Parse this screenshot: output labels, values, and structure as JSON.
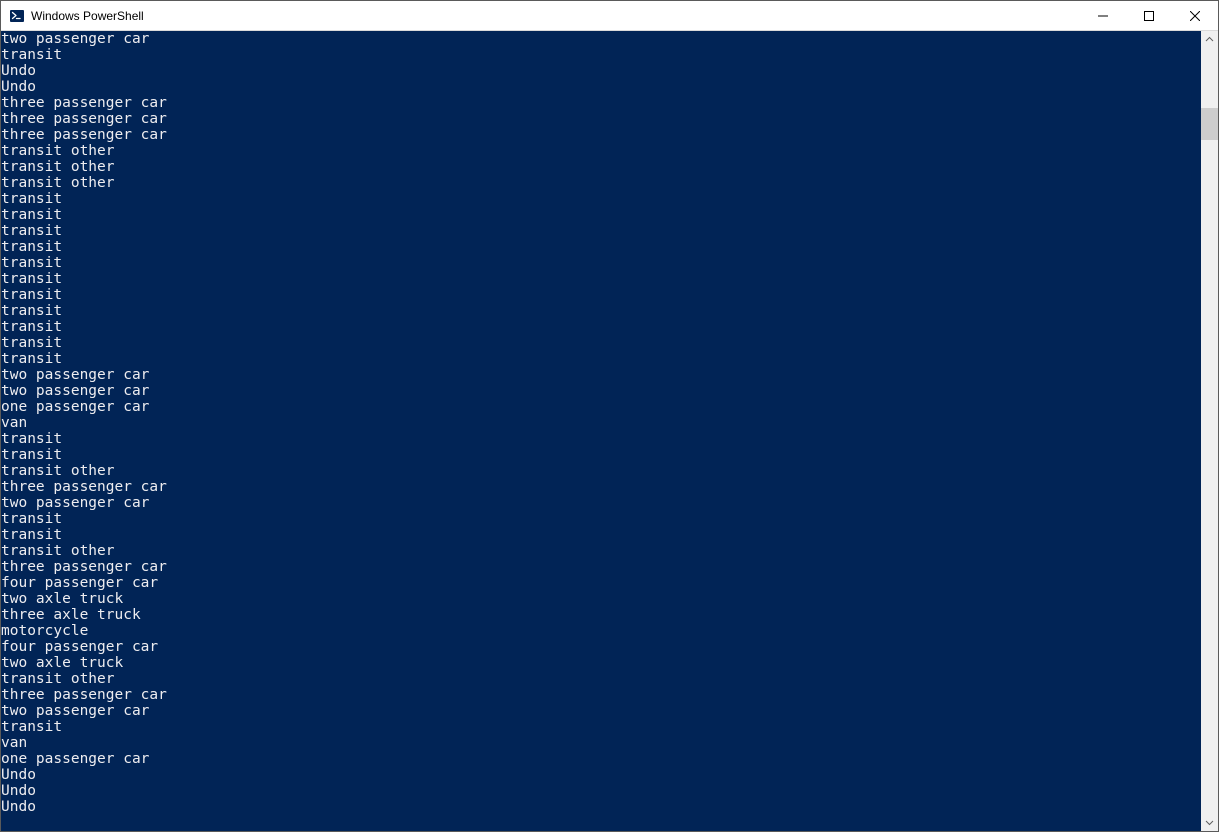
{
  "window": {
    "title": "Windows PowerShell"
  },
  "terminal": {
    "lines": [
      "two passenger car",
      "transit",
      "Undo",
      "Undo",
      "three passenger car",
      "three passenger car",
      "three passenger car",
      "transit other",
      "transit other",
      "transit other",
      "transit",
      "transit",
      "transit",
      "transit",
      "transit",
      "transit",
      "transit",
      "transit",
      "transit",
      "transit",
      "transit",
      "two passenger car",
      "two passenger car",
      "one passenger car",
      "van",
      "transit",
      "transit",
      "transit other",
      "three passenger car",
      "two passenger car",
      "transit",
      "transit",
      "transit other",
      "three passenger car",
      "four passenger car",
      "two axle truck",
      "three axle truck",
      "motorcycle",
      "four passenger car",
      "two axle truck",
      "transit other",
      "three passenger car",
      "two passenger car",
      "transit",
      "van",
      "one passenger car",
      "Undo",
      "Undo",
      "Undo"
    ]
  },
  "colors": {
    "terminal_bg": "#012456",
    "terminal_fg": "#eeedf0"
  }
}
